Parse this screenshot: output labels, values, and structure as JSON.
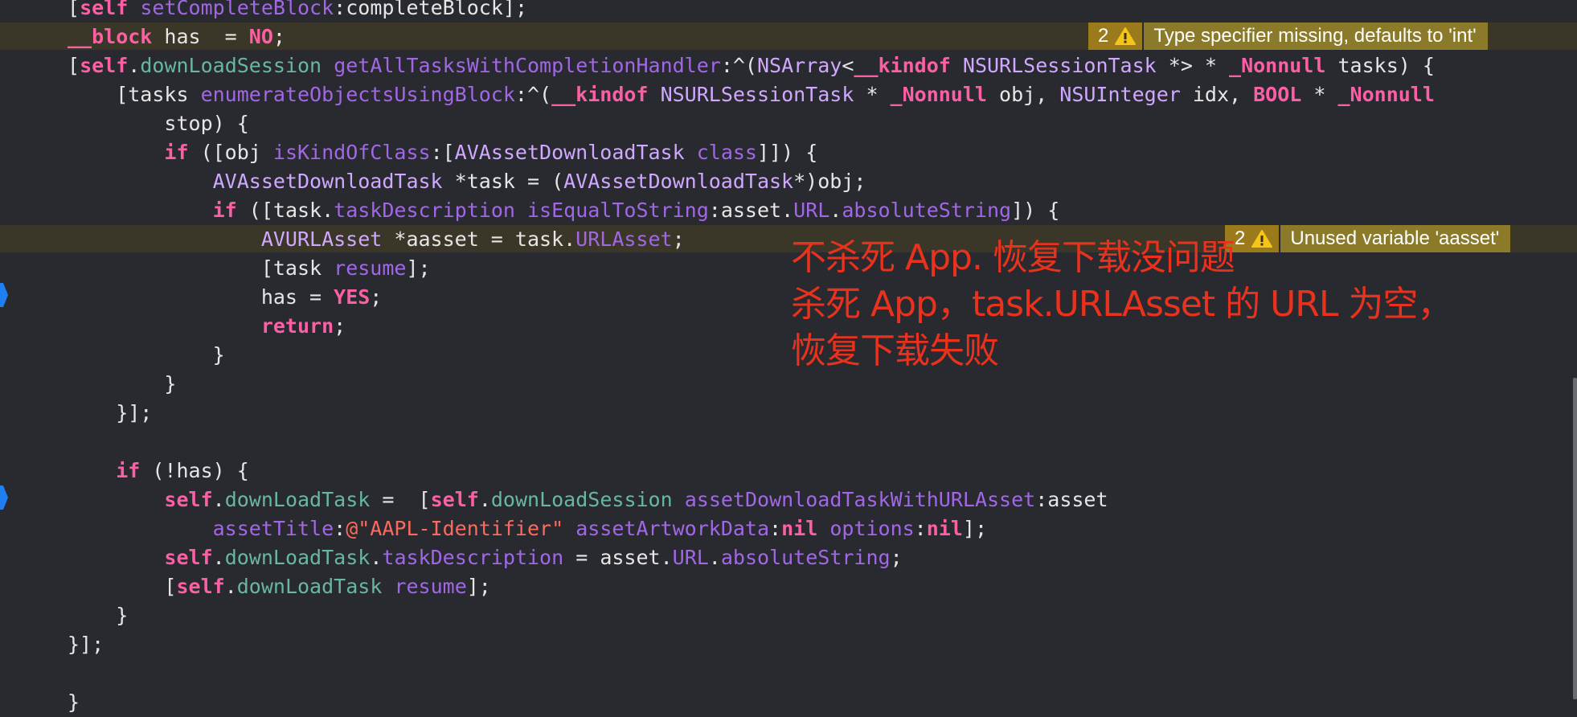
{
  "code_lines": [
    [
      [
        "t-plain",
        "["
      ],
      [
        "t-kw",
        "self"
      ],
      [
        "t-plain",
        " "
      ],
      [
        "t-method",
        "setCompleteBlock"
      ],
      [
        "t-plain",
        ":completeBlock];"
      ]
    ],
    [
      [
        "t-kw",
        "__block"
      ],
      [
        "t-plain",
        " has  = "
      ],
      [
        "t-kw",
        "NO"
      ],
      [
        "t-plain",
        ";"
      ]
    ],
    [
      [
        "t-plain",
        "["
      ],
      [
        "t-kw",
        "self"
      ],
      [
        "t-plain",
        "."
      ],
      [
        "t-prop",
        "downLoadSession"
      ],
      [
        "t-plain",
        " "
      ],
      [
        "t-method",
        "getAllTasksWithCompletionHandler"
      ],
      [
        "t-plain",
        ":^("
      ],
      [
        "t-type",
        "NSArray"
      ],
      [
        "t-plain",
        "<"
      ],
      [
        "t-kw",
        "__kindof"
      ],
      [
        "t-plain",
        " "
      ],
      [
        "t-type",
        "NSURLSessionTask"
      ],
      [
        "t-plain",
        " *> * "
      ],
      [
        "t-kw",
        "_Nonnull"
      ],
      [
        "t-plain",
        " tasks) {"
      ]
    ],
    [
      [
        "t-plain",
        "    [tasks "
      ],
      [
        "t-method",
        "enumerateObjectsUsingBlock"
      ],
      [
        "t-plain",
        ":^("
      ],
      [
        "t-kw",
        "__kindof"
      ],
      [
        "t-plain",
        " "
      ],
      [
        "t-type",
        "NSURLSessionTask"
      ],
      [
        "t-plain",
        " * "
      ],
      [
        "t-kw",
        "_Nonnull"
      ],
      [
        "t-plain",
        " obj, "
      ],
      [
        "t-type",
        "NSUInteger"
      ],
      [
        "t-plain",
        " idx, "
      ],
      [
        "t-kw",
        "BOOL"
      ],
      [
        "t-plain",
        " * "
      ],
      [
        "t-kw",
        "_Nonnull"
      ]
    ],
    [
      [
        "t-plain",
        "        stop) {"
      ]
    ],
    [
      [
        "t-plain",
        "        "
      ],
      [
        "t-kw",
        "if"
      ],
      [
        "t-plain",
        " ([obj "
      ],
      [
        "t-method",
        "isKindOfClass"
      ],
      [
        "t-plain",
        ":["
      ],
      [
        "t-type",
        "AVAssetDownloadTask"
      ],
      [
        "t-plain",
        " "
      ],
      [
        "t-method",
        "class"
      ],
      [
        "t-plain",
        "]]) {"
      ]
    ],
    [
      [
        "t-plain",
        "            "
      ],
      [
        "t-type",
        "AVAssetDownloadTask"
      ],
      [
        "t-plain",
        " *task = ("
      ],
      [
        "t-type",
        "AVAssetDownloadTask"
      ],
      [
        "t-plain",
        "*)obj;"
      ]
    ],
    [
      [
        "t-plain",
        "            "
      ],
      [
        "t-kw",
        "if"
      ],
      [
        "t-plain",
        " ([task."
      ],
      [
        "t-method",
        "taskDescription"
      ],
      [
        "t-plain",
        " "
      ],
      [
        "t-method",
        "isEqualToString"
      ],
      [
        "t-plain",
        ":asset."
      ],
      [
        "t-method",
        "URL"
      ],
      [
        "t-plain",
        "."
      ],
      [
        "t-method",
        "absoluteString"
      ],
      [
        "t-plain",
        "]) {"
      ]
    ],
    [
      [
        "t-plain",
        "                "
      ],
      [
        "t-type",
        "AVURLAsset"
      ],
      [
        "t-plain",
        " *aasset = task."
      ],
      [
        "t-method",
        "URLAsset"
      ],
      [
        "t-plain",
        ";"
      ]
    ],
    [
      [
        "t-plain",
        "                [task "
      ],
      [
        "t-method",
        "resume"
      ],
      [
        "t-plain",
        "];"
      ]
    ],
    [
      [
        "t-plain",
        "                has = "
      ],
      [
        "t-kw",
        "YES"
      ],
      [
        "t-plain",
        ";"
      ]
    ],
    [
      [
        "t-plain",
        "                "
      ],
      [
        "t-kw",
        "return"
      ],
      [
        "t-plain",
        ";"
      ]
    ],
    [
      [
        "t-plain",
        "            }"
      ]
    ],
    [
      [
        "t-plain",
        "        }"
      ]
    ],
    [
      [
        "t-plain",
        "    }];"
      ]
    ],
    [],
    [
      [
        "t-plain",
        "    "
      ],
      [
        "t-kw",
        "if"
      ],
      [
        "t-plain",
        " (!has) {"
      ]
    ],
    [
      [
        "t-plain",
        "        "
      ],
      [
        "t-kw",
        "self"
      ],
      [
        "t-plain",
        "."
      ],
      [
        "t-prop",
        "downLoadTask"
      ],
      [
        "t-plain",
        " =  ["
      ],
      [
        "t-kw",
        "self"
      ],
      [
        "t-plain",
        "."
      ],
      [
        "t-prop",
        "downLoadSession"
      ],
      [
        "t-plain",
        " "
      ],
      [
        "t-method",
        "assetDownloadTaskWithURLAsset"
      ],
      [
        "t-plain",
        ":asset"
      ]
    ],
    [
      [
        "t-plain",
        "            "
      ],
      [
        "t-method",
        "assetTitle"
      ],
      [
        "t-plain",
        ":"
      ],
      [
        "t-str",
        "@\"AAPL-Identifier\""
      ],
      [
        "t-plain",
        " "
      ],
      [
        "t-method",
        "assetArtworkData"
      ],
      [
        "t-plain",
        ":"
      ],
      [
        "t-kw",
        "nil"
      ],
      [
        "t-plain",
        " "
      ],
      [
        "t-method",
        "options"
      ],
      [
        "t-plain",
        ":"
      ],
      [
        "t-kw",
        "nil"
      ],
      [
        "t-plain",
        "];"
      ]
    ],
    [
      [
        "t-plain",
        "        "
      ],
      [
        "t-kw",
        "self"
      ],
      [
        "t-plain",
        "."
      ],
      [
        "t-prop",
        "downLoadTask"
      ],
      [
        "t-plain",
        "."
      ],
      [
        "t-method",
        "taskDescription"
      ],
      [
        "t-plain",
        " = asset."
      ],
      [
        "t-method",
        "URL"
      ],
      [
        "t-plain",
        "."
      ],
      [
        "t-method",
        "absoluteString"
      ],
      [
        "t-plain",
        ";"
      ]
    ],
    [
      [
        "t-plain",
        "        ["
      ],
      [
        "t-kw",
        "self"
      ],
      [
        "t-plain",
        "."
      ],
      [
        "t-prop",
        "downLoadTask"
      ],
      [
        "t-plain",
        " "
      ],
      [
        "t-method",
        "resume"
      ],
      [
        "t-plain",
        "];"
      ]
    ],
    [
      [
        "t-plain",
        "    }"
      ]
    ],
    [
      [
        "t-plain",
        "}];"
      ]
    ],
    [],
    [
      [
        "t-plain",
        "}"
      ]
    ]
  ],
  "issues": [
    {
      "count": "2",
      "message": "Type specifier missing, defaults to 'int'"
    },
    {
      "count": "2",
      "message": "Unused variable 'aasset'"
    }
  ],
  "annotation": {
    "line1": "不杀死 App. 恢复下载没问题",
    "line2": "杀死 App，task.URLAsset 的 URL 为空，",
    "line3": "恢复下载失败"
  },
  "colors": {
    "background": "#292a30",
    "keyword": "#fc5fa3",
    "method": "#a167e6",
    "property": "#67b7a4",
    "warning": "#9a7a1a",
    "annotation": "#e8321e",
    "breakpoint": "#1f7ff2"
  }
}
